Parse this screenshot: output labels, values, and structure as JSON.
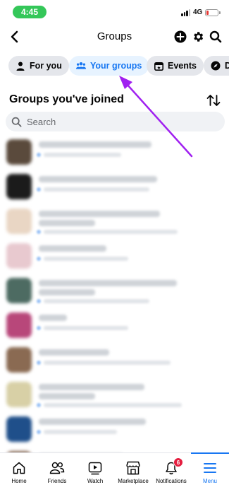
{
  "status_bar": {
    "time": "4:45",
    "network": "4G",
    "battery_level": 0.2
  },
  "header": {
    "title": "Groups"
  },
  "tabs": [
    {
      "label": "For you",
      "icon": "person-icon",
      "active": false
    },
    {
      "label": "Your groups",
      "icon": "people-icon",
      "active": true
    },
    {
      "label": "Events",
      "icon": "calendar-icon",
      "active": false
    },
    {
      "label": "D",
      "icon": "compass-icon",
      "active": false
    }
  ],
  "section": {
    "title": "Groups you've joined"
  },
  "search": {
    "placeholder": "Search"
  },
  "groups": [
    {
      "thumb_color": "#5a4a3c"
    },
    {
      "thumb_color": "#1b1b1b"
    },
    {
      "thumb_color": "#e9d6c4"
    },
    {
      "thumb_color": "#e8c9cf"
    },
    {
      "thumb_color": "#4d6b62"
    },
    {
      "thumb_color": "#b8477a"
    },
    {
      "thumb_color": "#8a6a52"
    },
    {
      "thumb_color": "#d8d0a6"
    },
    {
      "thumb_color": "#1f4f8a"
    },
    {
      "thumb_color": "#8c6f5c"
    }
  ],
  "bottom_nav": [
    {
      "label": "Home",
      "icon": "home-icon"
    },
    {
      "label": "Friends",
      "icon": "friends-icon"
    },
    {
      "label": "Watch",
      "icon": "watch-icon"
    },
    {
      "label": "Marketplace",
      "icon": "marketplace-icon"
    },
    {
      "label": "Notifications",
      "icon": "bell-icon",
      "badge": "6"
    },
    {
      "label": "Menu",
      "icon": "menu-icon",
      "active": true
    }
  ],
  "colors": {
    "accent": "#1877f2",
    "annotation_arrow": "#a020f0",
    "badge": "#e41e3f",
    "status_pill": "#34c759"
  }
}
